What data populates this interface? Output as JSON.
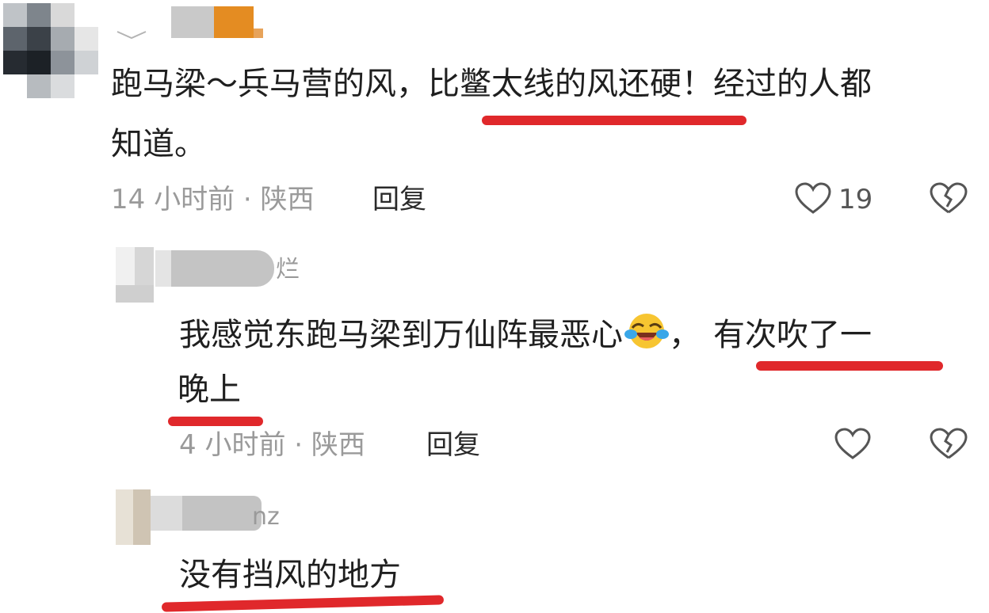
{
  "colors": {
    "underline": "#e0282b",
    "meta_gray": "#9a9a9a",
    "text": "#1f1f1f"
  },
  "comments": [
    {
      "text_part1": "跑马梁～兵马营的风，",
      "text_part2": "比鳖太线的风还硬",
      "text_part3": "！经过的人都",
      "text_line2": "知道。",
      "meta": "14 小时前 · 陕西",
      "reply_label": "回复",
      "like_count": "19"
    },
    {
      "username_tail": "烂",
      "text_part1": "我感觉东跑马梁到万仙阵最恶心",
      "text_part2": "，",
      "text_part3": "有次吹了一",
      "text_line2": "晚上",
      "meta": "4 小时前 · 陕西",
      "reply_label": "回复",
      "like_count": ""
    },
    {
      "username_tail": "nz",
      "text_line1": "没有挡风的地方"
    }
  ],
  "icons": {
    "like": "heart-outline-icon",
    "dislike": "broken-heart-icon",
    "emoji": "crying-laughing-emoji-icon",
    "chevron": "chevron-down-icon"
  }
}
